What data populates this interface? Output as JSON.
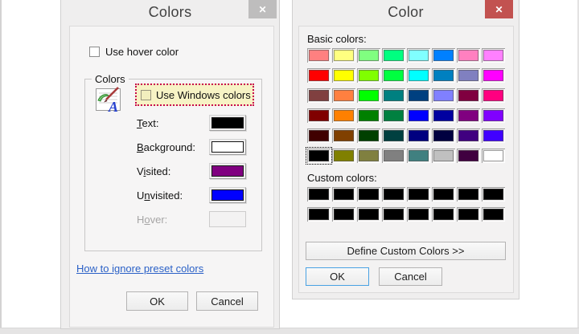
{
  "colors_dialog": {
    "title": "Colors",
    "close_label": "✕",
    "hover_checkbox_label": "Use hover color",
    "group_label": "Colors",
    "windows_colors_label": "Use Windows colors",
    "highlight": {
      "bg": "#F7F3C5",
      "border": "#C7074F"
    },
    "rows": [
      {
        "id": "text",
        "pre": "",
        "key": "T",
        "post": "ext:",
        "color": "#000000",
        "disabled": false
      },
      {
        "id": "background",
        "pre": "",
        "key": "B",
        "post": "ackground:",
        "color": "#FFFFFF",
        "disabled": false
      },
      {
        "id": "visited",
        "pre": "V",
        "key": "i",
        "post": "sited:",
        "color": "#800080",
        "disabled": false
      },
      {
        "id": "unvisited",
        "pre": "U",
        "key": "n",
        "post": "visited:",
        "color": "#0000FF",
        "disabled": false
      },
      {
        "id": "hover",
        "pre": "H",
        "key": "o",
        "post": "ver:",
        "color": null,
        "disabled": true
      }
    ],
    "link_label": "How to ignore preset colors",
    "ok_label": "OK",
    "cancel_label": "Cancel"
  },
  "color_dialog": {
    "title": "Color",
    "close_label": "✕",
    "close_color": "#C25250",
    "basic_label": "Basic colors:",
    "custom_label": "Custom colors:",
    "basic_colors": [
      "#FF8080",
      "#FFFF80",
      "#80FF80",
      "#00FF80",
      "#80FFFF",
      "#0080FF",
      "#FF80C0",
      "#FF80FF",
      "#FF0000",
      "#FFFF00",
      "#80FF00",
      "#00FF40",
      "#00FFFF",
      "#0080C0",
      "#8080C0",
      "#FF00FF",
      "#804040",
      "#FF8040",
      "#00FF00",
      "#008080",
      "#004080",
      "#8080FF",
      "#800040",
      "#FF0080",
      "#800000",
      "#FF8000",
      "#008000",
      "#008040",
      "#0000FF",
      "#0000A0",
      "#800080",
      "#8000FF",
      "#400000",
      "#804000",
      "#004000",
      "#004040",
      "#000080",
      "#000040",
      "#400080",
      "#4000FF",
      "#000000",
      "#808000",
      "#808040",
      "#808080",
      "#408080",
      "#C0C0C0",
      "#400040",
      "#FFFFFF"
    ],
    "selected_basic_index": 40,
    "custom_colors": [
      "#000000",
      "#000000",
      "#000000",
      "#000000",
      "#000000",
      "#000000",
      "#000000",
      "#000000",
      "#000000",
      "#000000",
      "#000000",
      "#000000",
      "#000000",
      "#000000",
      "#000000",
      "#000000"
    ],
    "define_button_label": "Define Custom Colors >>",
    "ok_label": "OK",
    "cancel_label": "Cancel"
  }
}
